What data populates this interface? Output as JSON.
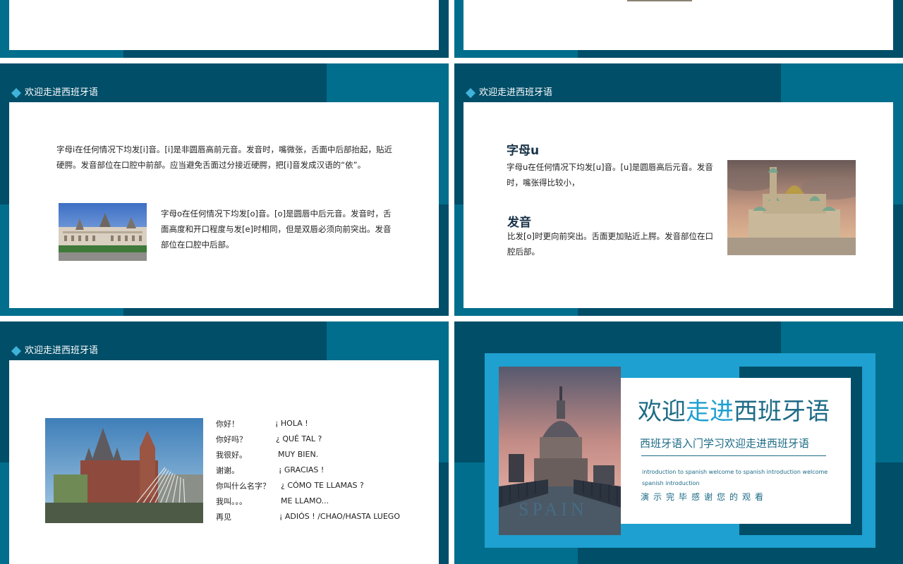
{
  "colors": {
    "dark_teal": "#004e68",
    "mid_teal": "#006e8c",
    "accent_blue": "#1ea0d0",
    "diamond": "#3fb3d9"
  },
  "slide_header": "欢迎走进西班牙语",
  "slide_i_o": {
    "letter_i": "字母i在任何情况下均发[i]音。[i]是非圆唇高前元音。发音时，嘴微张，舌面中后部抬起，贴近硬腭。发音部位在口腔中前部。应当避免舌面过分接近硬腭，把[i]音发成汉语的“依”。",
    "letter_o": "字母o在任何情况下均发[o]音。[o]是圆唇中后元音。发音时，舌面高度和开口程度与发[e]时相同，但是双唇必须向前突出。发音部位在口腔中后部。"
  },
  "slide_u": {
    "title": "字母u",
    "body": "字母u在任何情况下均发[u]音。[u]是圆唇高后元音。发音时，嘴张得比较小，",
    "subtitle": "发音",
    "body2": "比发[o]时更向前突出。舌面更加贴近上腭。发音部位在口腔后部。"
  },
  "slide_phrases": {
    "rows": [
      {
        "cn": "你好！",
        "es": "¡ HOLA !"
      },
      {
        "cn": "你好吗？",
        "es": "¿ QUÉ TAL ?"
      },
      {
        "cn": "我很好。",
        "es": "MUY BIEN."
      },
      {
        "cn": "谢谢。",
        "es": "¡ GRACIAS !"
      },
      {
        "cn": "你叫什么名字？",
        "es": "¿ CÓMO TE LLAMAS ?"
      },
      {
        "cn": "我叫。。。",
        "es": "ME LLAMO..."
      },
      {
        "cn": "再见",
        "es": "¡ ADIÓS ! /CHAO/HASTA LUEGO"
      }
    ]
  },
  "closing": {
    "title_part1": "欢迎",
    "title_part2": "走进",
    "title_part3": "西班牙语",
    "subtitle": "西班牙语入门学习欢迎走进西班牙语",
    "english": "introduction to spanish welcome to spanish introduction welcome spanish introduction",
    "thanks": "演示完毕感谢您的观看",
    "watermark": "SPAIN"
  }
}
